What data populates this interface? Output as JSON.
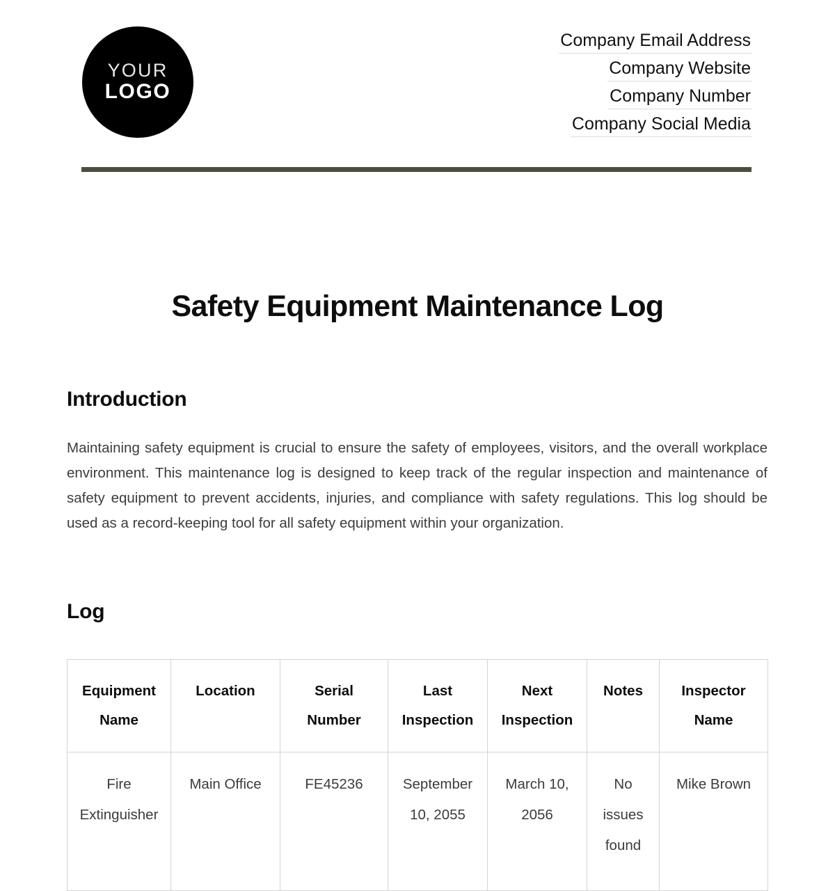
{
  "header": {
    "logo": {
      "line1": "YOUR",
      "line2": "LOGO"
    },
    "contacts": [
      {
        "label": "Company Email Address"
      },
      {
        "label": "Company Website"
      },
      {
        "label": "Company Number"
      },
      {
        "label": "Company Social Media"
      }
    ],
    "rule_color": "#4d4c40"
  },
  "document": {
    "title": "Safety Equipment Maintenance Log"
  },
  "sections": {
    "introduction": {
      "heading": "Introduction",
      "body": "Maintaining safety equipment is crucial to ensure the safety of employees, visitors, and the overall workplace environment. This maintenance log is designed to keep track of the regular inspection and maintenance of safety equipment to prevent accidents, injuries, and compliance with safety regulations. This log should be used as a record-keeping tool for all safety equipment within your organization."
    },
    "log": {
      "heading": "Log"
    }
  },
  "table": {
    "columns": [
      "Equipment Name",
      "Location",
      "Serial Number",
      "Last Inspection",
      "Next Inspection",
      "Notes",
      "Inspector Name"
    ],
    "rows": [
      {
        "equipment_name": "Fire Extinguisher",
        "location": "Main Office",
        "serial_number": "FE45236",
        "last_inspection": "September 10, 2055",
        "next_inspection": "March 10, 2056",
        "notes": "No issues found",
        "inspector_name": "Mike Brown"
      }
    ]
  },
  "colors": {
    "text_primary": "#0d0d0d",
    "text_body": "#3c3c3c",
    "rule": "#4d4c40",
    "table_border": "#d4d4d4",
    "underline": "#dcdcdc",
    "logo_bg": "#000000"
  }
}
